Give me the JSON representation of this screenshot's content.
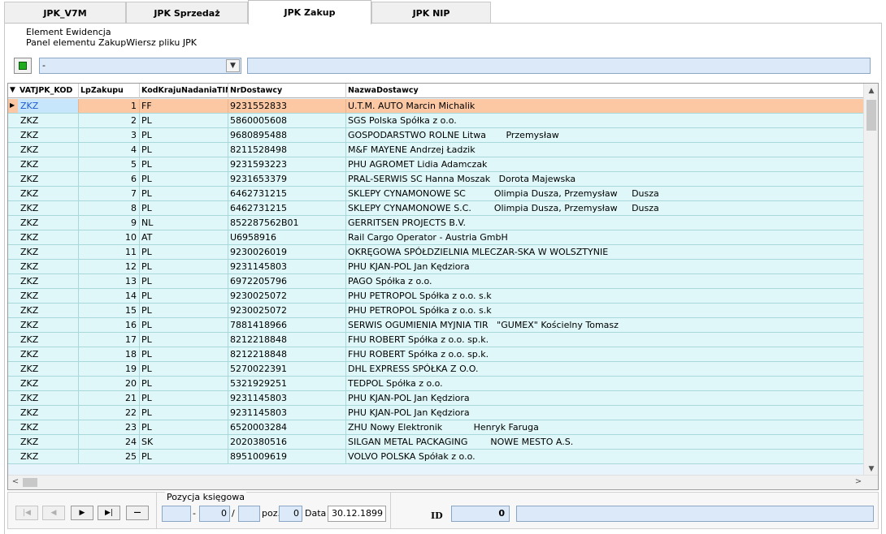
{
  "tabs": [
    {
      "label": "JPK_V7M"
    },
    {
      "label": "JPK Sprzedaż"
    },
    {
      "label": "JPK Zakup"
    },
    {
      "label": "JPK NIP"
    }
  ],
  "info": {
    "line1": "Element Ewidencja",
    "line2": "Panel elementu ZakupWiersz pliku JPK"
  },
  "filter": {
    "combo_value": "-",
    "text_value": ""
  },
  "grid": {
    "columns": [
      "VATJPK_KOD",
      "LpZakupu",
      "KodKrajuNadaniaTIN",
      "NrDostawcy",
      "NazwaDostawcy"
    ],
    "rows": [
      {
        "kod": "ZKZ",
        "lp": "1",
        "kraj": "FF",
        "nr": "9231552833",
        "nazwa": "U.T.M. AUTO Marcin Michalik"
      },
      {
        "kod": "ZKZ",
        "lp": "2",
        "kraj": "PL",
        "nr": "5860005608",
        "nazwa": "SGS Polska Spółka z o.o."
      },
      {
        "kod": "ZKZ",
        "lp": "3",
        "kraj": "PL",
        "nr": "9680895488",
        "nazwa": "GOSPODARSTWO ROLNE Litwa       Przemysław"
      },
      {
        "kod": "ZKZ",
        "lp": "4",
        "kraj": "PL",
        "nr": "8211528498",
        "nazwa": "M&F MAYENE Andrzej Ładzik"
      },
      {
        "kod": "ZKZ",
        "lp": "5",
        "kraj": "PL",
        "nr": "9231593223",
        "nazwa": "PHU AGROMET Lidia Adamczak"
      },
      {
        "kod": "ZKZ",
        "lp": "6",
        "kraj": "PL",
        "nr": "9231653379",
        "nazwa": "PRAL-SERWIS SC Hanna Moszak   Dorota Majewska"
      },
      {
        "kod": "ZKZ",
        "lp": "7",
        "kraj": "PL",
        "nr": "6462731215",
        "nazwa": "SKLEPY CYNAMONOWE SC          Olimpia Dusza, Przemysław     Dusza"
      },
      {
        "kod": "ZKZ",
        "lp": "8",
        "kraj": "PL",
        "nr": "6462731215",
        "nazwa": "SKLEPY CYNAMONOWE S.C.        Olimpia Dusza, Przemysław     Dusza"
      },
      {
        "kod": "ZKZ",
        "lp": "9",
        "kraj": "NL",
        "nr": "852287562B01",
        "nazwa": "GERRITSEN PROJECTS B.V."
      },
      {
        "kod": "ZKZ",
        "lp": "10",
        "kraj": "AT",
        "nr": "U6958916",
        "nazwa": "Rail Cargo Operator - Austria GmbH"
      },
      {
        "kod": "ZKZ",
        "lp": "11",
        "kraj": "PL",
        "nr": "9230026019",
        "nazwa": "OKRĘGOWA SPÓŁDZIELNIA MLECZAR-SKA W WOLSZTYNIE"
      },
      {
        "kod": "ZKZ",
        "lp": "12",
        "kraj": "PL",
        "nr": "9231145803",
        "nazwa": "PHU KJAN-POL Jan Kędziora"
      },
      {
        "kod": "ZKZ",
        "lp": "13",
        "kraj": "PL",
        "nr": "6972205796",
        "nazwa": "PAGO Spółka z o.o."
      },
      {
        "kod": "ZKZ",
        "lp": "14",
        "kraj": "PL",
        "nr": "9230025072",
        "nazwa": "PHU PETROPOL Spółka z o.o. s.k"
      },
      {
        "kod": "ZKZ",
        "lp": "15",
        "kraj": "PL",
        "nr": "9230025072",
        "nazwa": "PHU PETROPOL Spółka z o.o. s.k"
      },
      {
        "kod": "ZKZ",
        "lp": "16",
        "kraj": "PL",
        "nr": "7881418966",
        "nazwa": "SERWIS OGUMIENIA MYJNIA TIR   \"GUMEX\" Kościelny Tomasz"
      },
      {
        "kod": "ZKZ",
        "lp": "17",
        "kraj": "PL",
        "nr": "8212218848",
        "nazwa": "FHU ROBERT Spółka z o.o. sp.k."
      },
      {
        "kod": "ZKZ",
        "lp": "18",
        "kraj": "PL",
        "nr": "8212218848",
        "nazwa": "FHU ROBERT Spółka z o.o. sp.k."
      },
      {
        "kod": "ZKZ",
        "lp": "19",
        "kraj": "PL",
        "nr": "5270022391",
        "nazwa": "DHL EXPRESS SPÓŁKA Z O.O."
      },
      {
        "kod": "ZKZ",
        "lp": "20",
        "kraj": "PL",
        "nr": "5321929251",
        "nazwa": "TEDPOL Spółka z o.o."
      },
      {
        "kod": "ZKZ",
        "lp": "21",
        "kraj": "PL",
        "nr": "9231145803",
        "nazwa": "PHU KJAN-POL Jan Kędziora"
      },
      {
        "kod": "ZKZ",
        "lp": "22",
        "kraj": "PL",
        "nr": "9231145803",
        "nazwa": "PHU KJAN-POL Jan Kędziora"
      },
      {
        "kod": "ZKZ",
        "lp": "23",
        "kraj": "PL",
        "nr": "6520003284",
        "nazwa": "ZHU Nowy Elektronik           Henryk Faruga"
      },
      {
        "kod": "ZKZ",
        "lp": "24",
        "kraj": "SK",
        "nr": "2020380516",
        "nazwa": "SILGAN METAL PACKAGING        NOWE MESTO A.S."
      },
      {
        "kod": "ZKZ",
        "lp": "25",
        "kraj": "PL",
        "nr": "8951009619",
        "nazwa": "VOLVO POLSKA Spółak z o.o."
      }
    ]
  },
  "navigator": {
    "first": "|◀",
    "prev": "◀",
    "next": "▶",
    "last": "▶|",
    "delete": "—"
  },
  "position": {
    "title": "Pozycja księgowa",
    "field1": "",
    "sep1": "-",
    "field2": "0",
    "sep2": "/",
    "field3": "",
    "poz_label": "poz.",
    "poz_value": "0",
    "date_label": "Data",
    "date_value": "30.12.1899"
  },
  "id": {
    "label": "ID",
    "value": "0",
    "extra": ""
  },
  "colors": {
    "selected_row": "#fcc8a4",
    "row_bg": "#dff7f8",
    "field_bg": "#dbe9f8",
    "indicator_green": "#1faa1f"
  }
}
